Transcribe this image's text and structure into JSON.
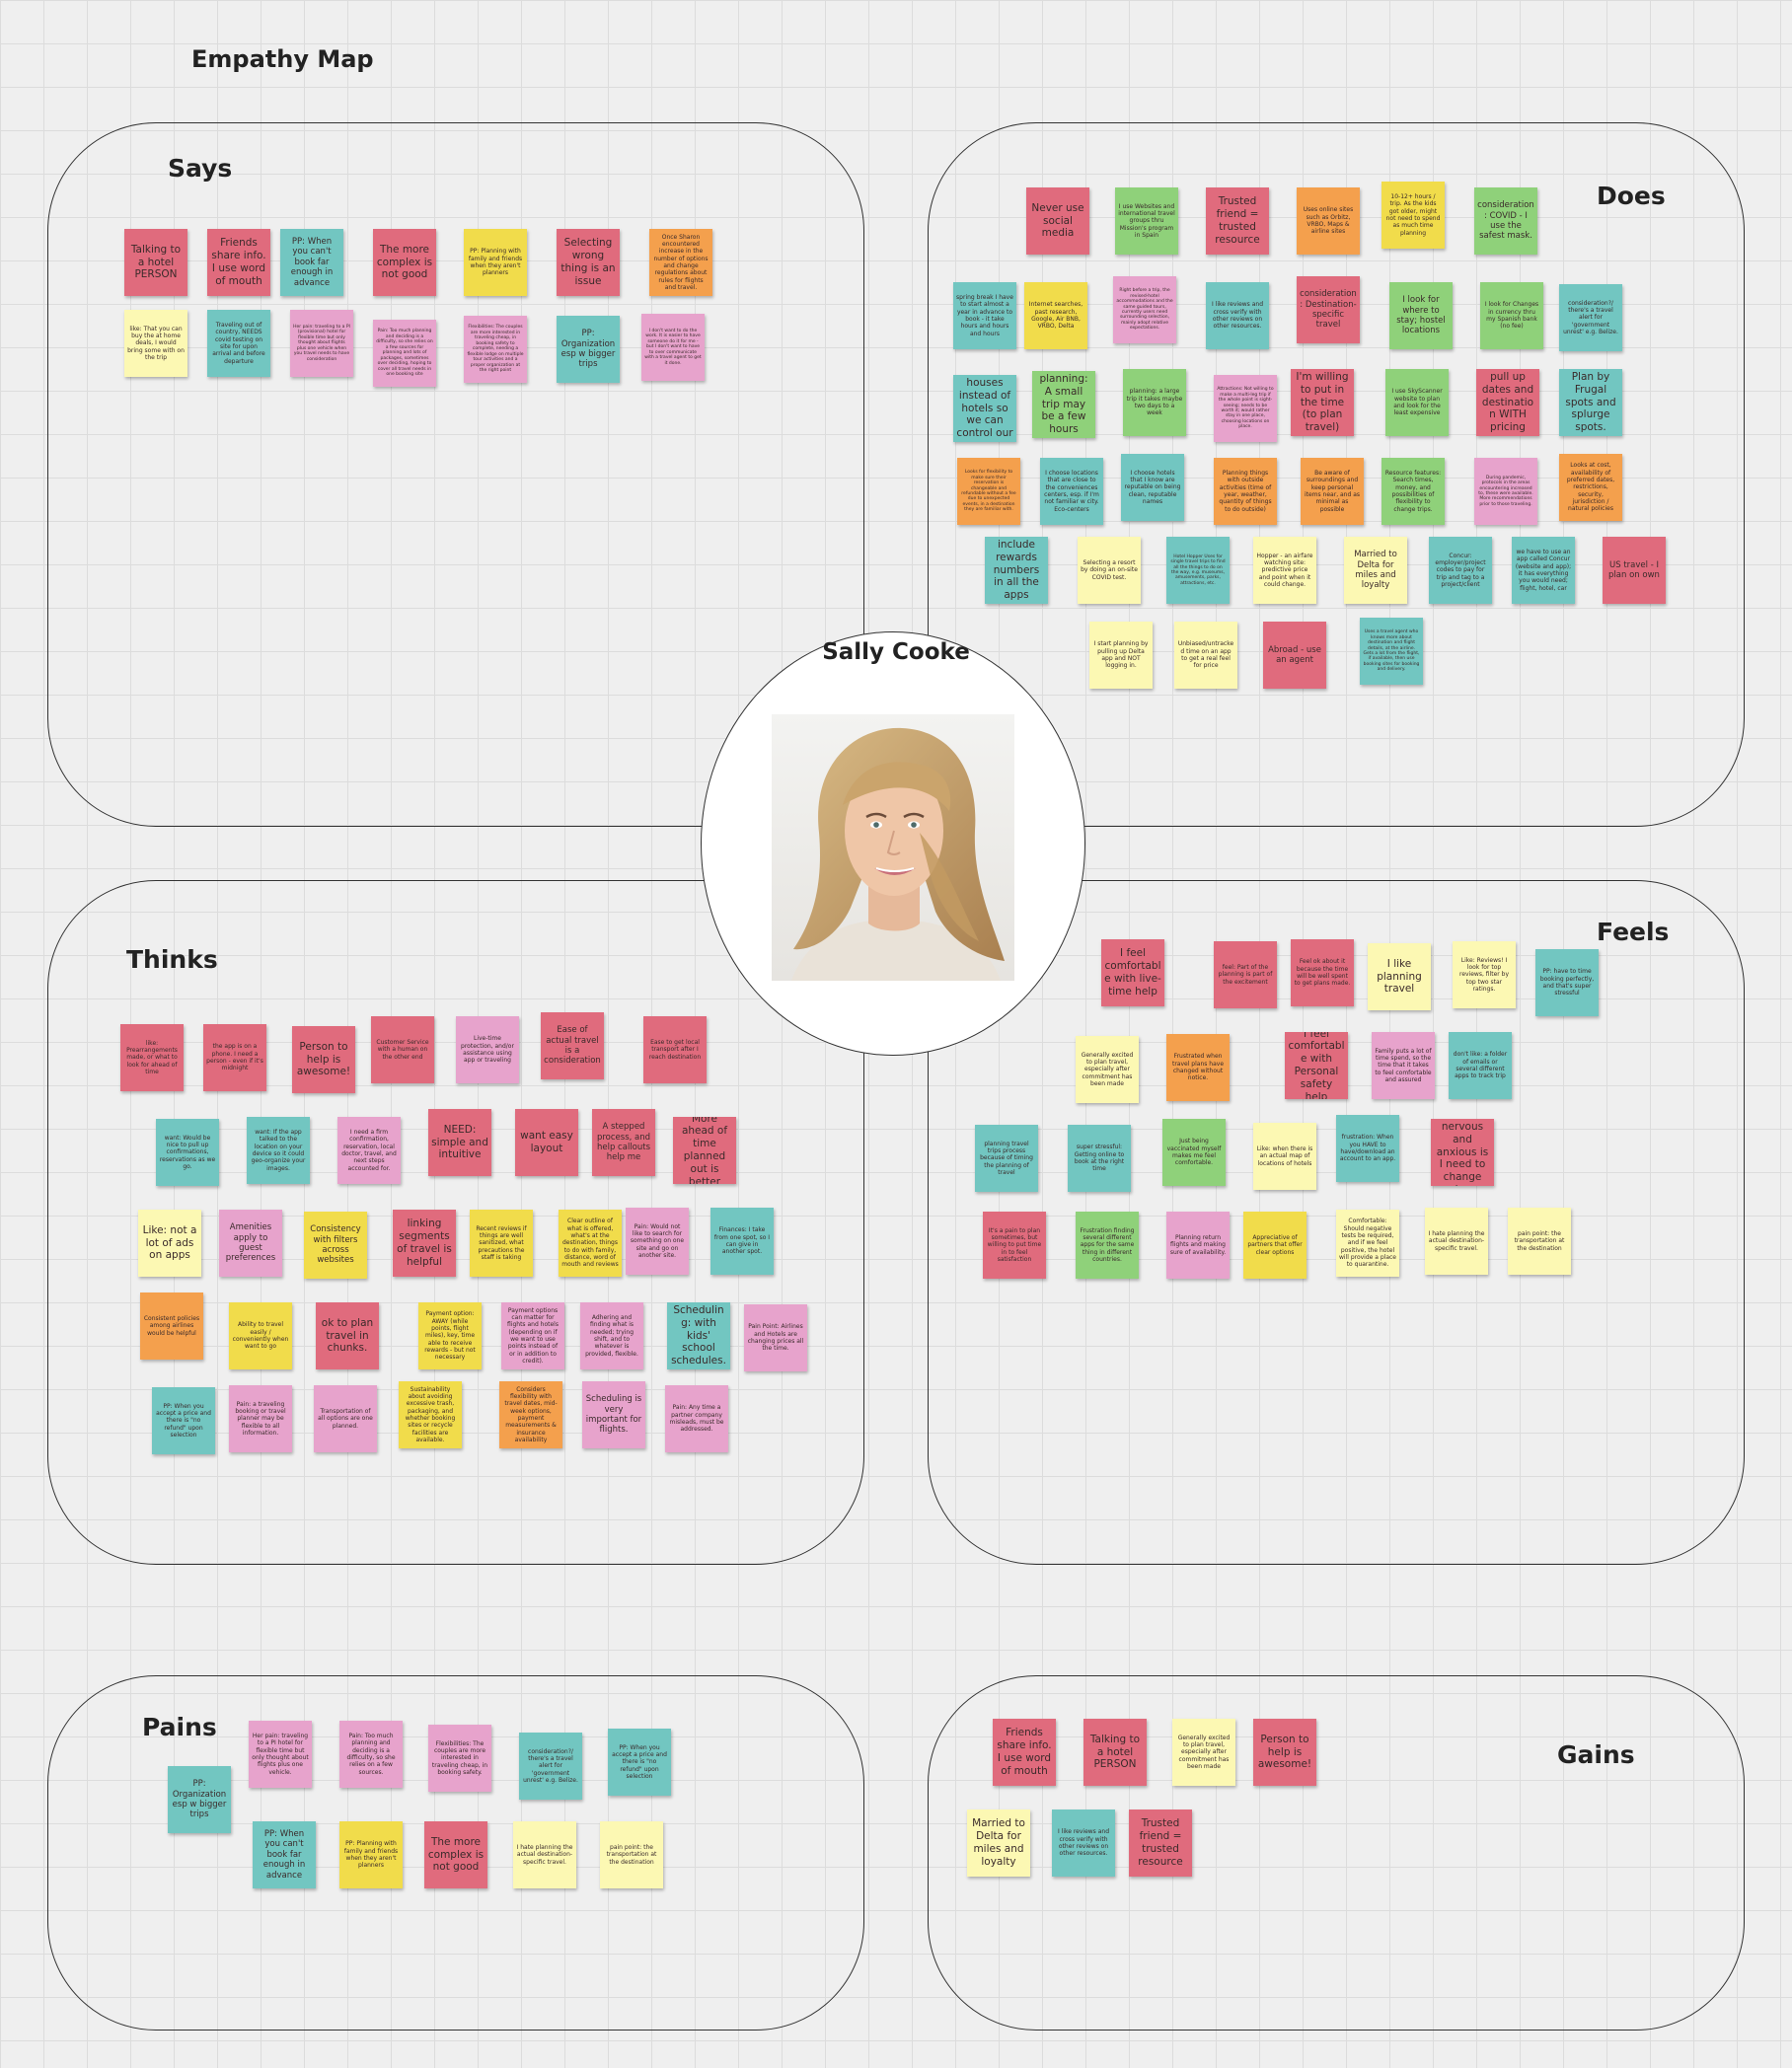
{
  "board_title": "Empathy Map",
  "persona": {
    "name": "Sally Cooke",
    "photo": "portrait-photo"
  },
  "quadrants": {
    "says": {
      "label": "Says",
      "notes": [
        {
          "text": "Talking to a hotel PERSON",
          "color": "red"
        },
        {
          "text": "Friends share info. I use word of mouth",
          "color": "red"
        },
        {
          "text": "PP: When you can't book far enough in advance",
          "color": "teal"
        },
        {
          "text": "The more complex is not good",
          "color": "red"
        },
        {
          "text": "PP: Planning with family and friends when they aren't planners",
          "color": "yellow"
        },
        {
          "text": "Selecting wrong thing is an issue",
          "color": "red"
        },
        {
          "text": "Once Sharon encountered increase in the number of options and change regulations about rules for flights and travel.",
          "color": "orange"
        },
        {
          "text": "like: That you can buy the at home deals, I would bring some with on the trip",
          "color": "lyellow"
        },
        {
          "text": "Traveling out of country, NEEDS covid testing on site for upon arrival and before departure",
          "color": "teal"
        },
        {
          "text": "Her pain: traveling to a PI (provisional) hotel for flexible time but only thought about flights plus one vehicle when you travel needs to have consideration",
          "color": "pink"
        },
        {
          "text": "Pain: Too much planning and deciding is a difficulty, so she relies on a few sources for planning and lots of packages, sometimes over deciding, hoping to cover all travel needs in one booking site",
          "color": "pink"
        },
        {
          "text": "Flexibilities: The couples are more interested in traveling cheap, in booking safety to complete, needing a flexible lodge on multiple tour activities and a proper organization at the right point",
          "color": "pink"
        },
        {
          "text": "PP: Organization esp w bigger trips",
          "color": "teal"
        },
        {
          "text": "I don't want to do the work. It is easier to have someone do it for me - but I don't want to have to over communicate with a travel agent to get it done.",
          "color": "pink"
        }
      ]
    },
    "does": {
      "label": "Does",
      "notes": [
        {
          "text": "Never use social media",
          "color": "red"
        },
        {
          "text": "I use Websites and international travel groups thru Mission's program in Spain",
          "color": "green"
        },
        {
          "text": "Trusted friend = trusted resource",
          "color": "red"
        },
        {
          "text": "Uses online sites such as Orbitz, VRBO, Maps & airline sites",
          "color": "orange"
        },
        {
          "text": "10-12+ hours / trip. As the kids got older, might not need to spend as much time planning",
          "color": "yellow"
        },
        {
          "text": "consideration: COVID - I use the safest mask.",
          "color": "green"
        },
        {
          "text": "spring break I have to start almost a year in advance to book - it take hours and hours and hours",
          "color": "teal"
        },
        {
          "text": "Internet searches, past research, Google, Air BNB, VRBO, Delta",
          "color": "yellow"
        },
        {
          "text": "Right before a trip, the revised-hotel accommodations and the same guided tours, currently users need surrounding selection, mainly adopt relative expectations.",
          "color": "pink"
        },
        {
          "text": "I like reviews and cross verify with other reviews on other resources.",
          "color": "teal"
        },
        {
          "text": "consideration: Destination-specific travel",
          "color": "red"
        },
        {
          "text": "I look for where to stay; hostel locations",
          "color": "green"
        },
        {
          "text": "I look for Changes in currency thru my Spanish bank (no fee)",
          "color": "green"
        },
        {
          "text": "consideration?/ there's a travel alert for 'government unrest' e.g. Belize.",
          "color": "teal"
        },
        {
          "text": "renting houses instead of hotels so we can control our own space",
          "color": "teal"
        },
        {
          "text": "planning: A small trip may be a few hours",
          "color": "green"
        },
        {
          "text": "planning: a large trip it takes maybe two days to a week",
          "color": "green"
        },
        {
          "text": "Attractions: Not willing to make a multi-leg trip if the whole point is sight-seeing; needs to be worth it; would rather stay in one place, choosing locations on place.",
          "color": "pink"
        },
        {
          "text": "I'm willing to put in the time (to plan travel)",
          "color": "red"
        },
        {
          "text": "I use SkyScanner website to plan and look for the least expensive",
          "color": "green"
        },
        {
          "text": "pull up dates and destination WITH pricing",
          "color": "red"
        },
        {
          "text": "Plan by Frugal spots and splurge spots.",
          "color": "teal"
        },
        {
          "text": "Looks for flexibility to make sure their reservation is changeable and refundable without a fee due to unexpected events, in a destination they are familiar with.",
          "color": "orange"
        },
        {
          "text": "I choose locations that are close to the conveniences centers, esp. if I'm not familiar w city. Eco-centers",
          "color": "teal"
        },
        {
          "text": "I choose hotels that I know are reputable on being clean, reputable names",
          "color": "teal"
        },
        {
          "text": "Planning things with outside activities (time of year, weather, quantity of things to do outside)",
          "color": "orange"
        },
        {
          "text": "Be aware of surroundings and keep personal items near, and as minimal as possible",
          "color": "orange"
        },
        {
          "text": "Resource features: Search times, money, and possibilities of flexibility to change trips.",
          "color": "green"
        },
        {
          "text": "During pandemic, protocols in the areas encountering increased to, these were available. More recommendations prior to those traveling.",
          "color": "pink"
        },
        {
          "text": "Looks at cost, availability of preferred dates, restrictions, security, jurisdiction / natural policies",
          "color": "orange"
        },
        {
          "text": "include rewards numbers in all the apps",
          "color": "teal"
        },
        {
          "text": "Selecting a resort by doing an on-site COVID test.",
          "color": "lyellow"
        },
        {
          "text": "Hotel Hopper Uses for single travel trips to find all the things to do on the way, e.g. museums, amusements, parks, attractions, etc.",
          "color": "teal"
        },
        {
          "text": "Hopper - an airfare watching site: predictive price and point when it could change.",
          "color": "lyellow"
        },
        {
          "text": "Married to Delta for miles and loyalty",
          "color": "lyellow"
        },
        {
          "text": "Concur: employer/project codes to pay for trip and tag to a project/client",
          "color": "teal"
        },
        {
          "text": "we have to use an app called Concur (website and app); it has everything you would need; flight, hotel, car",
          "color": "teal"
        },
        {
          "text": "US travel - I plan on own",
          "color": "red"
        },
        {
          "text": "I start planning by pulling up Delta app and NOT logging in.",
          "color": "lyellow"
        },
        {
          "text": "Unbiased/untracked time on an app to get a real feel for price",
          "color": "lyellow"
        },
        {
          "text": "Abroad - use an agent",
          "color": "red"
        },
        {
          "text": "Uses a travel agent who knows more about destination and flight details, at the airline. Gets a lot from the flight, if available, then use booking sites for booking and delivery.",
          "color": "teal"
        }
      ]
    },
    "thinks": {
      "label": "Thinks",
      "notes": [
        {
          "text": "like: Prearrangements made, or what to look for ahead of time",
          "color": "red"
        },
        {
          "text": "the app is on a phone. I need a person - even if it's midnight",
          "color": "red"
        },
        {
          "text": "Person to help is awesome!",
          "color": "red"
        },
        {
          "text": "Customer Service with a human on the other end",
          "color": "red"
        },
        {
          "text": "Live-time protection, and/or assistance using app or traveling",
          "color": "pink"
        },
        {
          "text": "Ease of actual travel is a consideration",
          "color": "red"
        },
        {
          "text": "Ease to get local transport after I reach destination",
          "color": "red"
        },
        {
          "text": "want: Would be nice to pull up confirmations, reservations as we go.",
          "color": "teal"
        },
        {
          "text": "want: If the app talked to the location on your device so it could geo-organize your images.",
          "color": "teal"
        },
        {
          "text": "I need a firm confirmation, reservation, local doctor, travel, and next steps accounted for.",
          "color": "pink"
        },
        {
          "text": "NEED: simple and intuitive",
          "color": "red"
        },
        {
          "text": "want easy layout",
          "color": "red"
        },
        {
          "text": "A stepped process, and help callouts help me",
          "color": "red"
        },
        {
          "text": "More ahead of time planned out is better",
          "color": "red"
        },
        {
          "text": "Like: not a lot of ads on apps",
          "color": "lyellow"
        },
        {
          "text": "Amenities apply to guest preferences",
          "color": "pink"
        },
        {
          "text": "Consistency with filters across websites",
          "color": "yellow"
        },
        {
          "text": "linking segments of travel is helpful",
          "color": "red"
        },
        {
          "text": "Recent reviews if things are well sanitized, what precautions the staff is taking",
          "color": "yellow"
        },
        {
          "text": "Clear outline of what is offered, what's at the destination, things to do with family, distance, word of mouth and reviews",
          "color": "yellow"
        },
        {
          "text": "Pain: Would not like to search for something on one site and go on another site.",
          "color": "pink"
        },
        {
          "text": "Finances: I take from one spot, so I can give in another spot.",
          "color": "teal"
        },
        {
          "text": "Consistent policies among airlines would be helpful",
          "color": "orange"
        },
        {
          "text": "Ability to travel easily / conveniently when want to go",
          "color": "yellow"
        },
        {
          "text": "ok to plan travel in chunks.",
          "color": "red"
        },
        {
          "text": "Payment option: AWAY (while points, flight miles), key, time able to receive rewards - but not necessary",
          "color": "yellow"
        },
        {
          "text": "Payment options can matter for flights and hotels (depending on if we want to use points instead of or in addition to credit).",
          "color": "pink"
        },
        {
          "text": "Adhering and finding what is needed; trying shift, and to whatever is provided, flexible.",
          "color": "pink"
        },
        {
          "text": "Scheduling: with kids' school schedules.",
          "color": "teal"
        },
        {
          "text": "Pain Point: Airlines and Hotels are changing prices all the time.",
          "color": "pink"
        },
        {
          "text": "PP: When you accept a price and there is \"no refund\" upon selection",
          "color": "teal"
        },
        {
          "text": "Pain: a traveling booking or travel planner may be flexible to all information.",
          "color": "pink"
        },
        {
          "text": "Transportation of all options are one planned.",
          "color": "pink"
        },
        {
          "text": "Sustainability about avoiding excessive trash, packaging, and whether booking sites or recycle facilities are available.",
          "color": "yellow"
        },
        {
          "text": "Considers flexibility with travel dates, mid-week options, payment measurements & insurance availability",
          "color": "orange"
        },
        {
          "text": "Scheduling is very important for flights.",
          "color": "pink"
        },
        {
          "text": "Pain: Any time a partner company misleads, must be addressed.",
          "color": "pink"
        }
      ]
    },
    "feels": {
      "label": "Feels",
      "notes": [
        {
          "text": "I feel comfortable with live-time help",
          "color": "red"
        },
        {
          "text": "feel: Part of the planning is part of the excitement",
          "color": "red"
        },
        {
          "text": "Feel ok about it because the time will be well spent to get plans made.",
          "color": "red"
        },
        {
          "text": "I like planning travel",
          "color": "lyellow"
        },
        {
          "text": "Like: Reviews! I look for top reviews, filter by top two star ratings.",
          "color": "lyellow"
        },
        {
          "text": "PP: have to time booking perfectly, and that's super stressful",
          "color": "teal"
        },
        {
          "text": "Generally excited to plan travel, especially after commitment has been made",
          "color": "lyellow"
        },
        {
          "text": "Frustrated when travel plans have changed without notice.",
          "color": "orange"
        },
        {
          "text": "I feel comfortable with Personal safety help",
          "color": "red"
        },
        {
          "text": "Family puts a lot of time spend, so the time that it takes to feel comfortable and assured",
          "color": "pink"
        },
        {
          "text": "don't like: a folder of emails or several different apps to track trip",
          "color": "teal"
        },
        {
          "text": "planning travel trips process because of timing the planning of travel",
          "color": "teal"
        },
        {
          "text": "super stressful: Getting online to book at the right time",
          "color": "teal"
        },
        {
          "text": "Just being vaccinated myself makes me feel comfortable.",
          "color": "green"
        },
        {
          "text": "Like: when there is an actual map of locations of hotels",
          "color": "lyellow"
        },
        {
          "text": "frustration: When you HAVE to have/download an account to an app.",
          "color": "teal"
        },
        {
          "text": "I can get nervous and anxious is I need to change plans",
          "color": "red"
        },
        {
          "text": "It's a pain to plan sometimes, but willing to put time in to feel satisfaction",
          "color": "red"
        },
        {
          "text": "Frustration finding several different apps for the same thing in different countries.",
          "color": "green"
        },
        {
          "text": "Planning return flights and making sure of availability.",
          "color": "pink"
        },
        {
          "text": "Appreciative of partners that offer clear options",
          "color": "yellow"
        },
        {
          "text": "Comfortable: Should negative tests be required, and if we feel positive, the hotel will provide a place to quarantine.",
          "color": "lyellow"
        },
        {
          "text": "I hate planning the actual destination-specific travel.",
          "color": "lyellow"
        },
        {
          "text": "pain point: the transportation at the destination",
          "color": "lyellow"
        }
      ]
    },
    "pains": {
      "label": "Pains",
      "notes": [
        {
          "text": "PP: Organization esp w bigger trips",
          "color": "teal"
        },
        {
          "text": "Her pain: traveling to a PI hotel for flexible time but only thought about flights plus one vehicle.",
          "color": "pink"
        },
        {
          "text": "Pain: Too much planning and deciding is a difficulty, so she relies on a few sources.",
          "color": "pink"
        },
        {
          "text": "Flexibilities: The couples are more interested in traveling cheap, in booking safety.",
          "color": "pink"
        },
        {
          "text": "consideration?/ there's a travel alert for 'government unrest' e.g. Belize.",
          "color": "teal"
        },
        {
          "text": "PP: When you accept a price and there is \"no refund\" upon selection",
          "color": "teal"
        },
        {
          "text": "PP: When you can't book far enough in advance",
          "color": "teal"
        },
        {
          "text": "PP: Planning with family and friends when they aren't planners",
          "color": "yellow"
        },
        {
          "text": "The more complex is not good",
          "color": "red"
        },
        {
          "text": "I hate planning the actual destination-specific travel.",
          "color": "lyellow"
        },
        {
          "text": "pain point: the transportation at the destination",
          "color": "lyellow"
        }
      ]
    },
    "gains": {
      "label": "Gains",
      "notes": [
        {
          "text": "Friends share info. I use word of mouth",
          "color": "red"
        },
        {
          "text": "Talking to a hotel PERSON",
          "color": "red"
        },
        {
          "text": "Generally excited to plan travel, especially after commitment has been made",
          "color": "lyellow"
        },
        {
          "text": "Person to help is awesome!",
          "color": "red"
        },
        {
          "text": "Married to Delta for miles and loyalty",
          "color": "lyellow"
        },
        {
          "text": "I like reviews and cross verify with other reviews on other resources.",
          "color": "teal"
        },
        {
          "text": "Trusted friend = trusted resource",
          "color": "red"
        }
      ]
    }
  }
}
